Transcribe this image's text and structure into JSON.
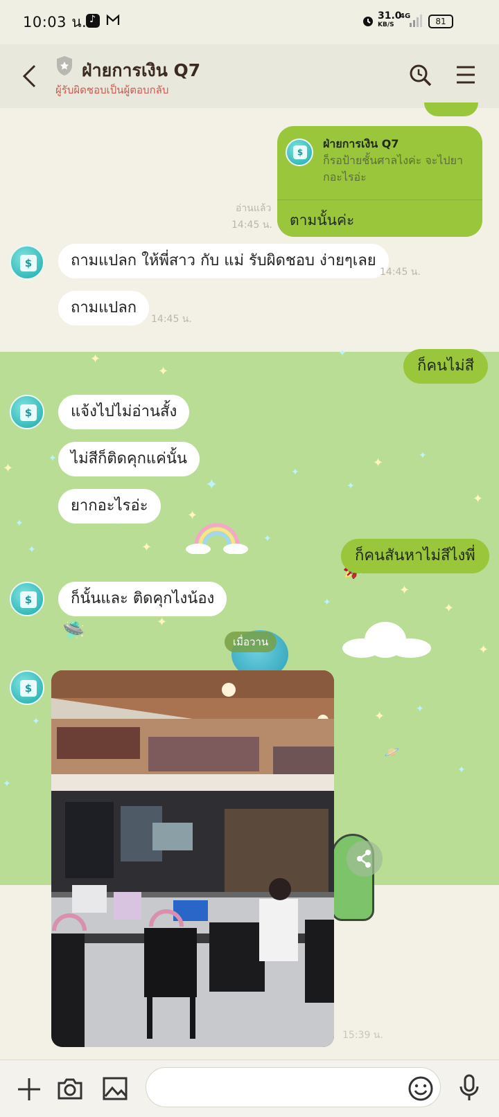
{
  "status_bar": {
    "time": "10:03 น.",
    "net_speed": "31.0",
    "net_unit": "KB/S",
    "network": "4G",
    "battery": "81"
  },
  "header": {
    "title": "ฝ่ายการเงิน Q7",
    "subtitle": "ผู้รับผิดชอบเป็นผู้ตอบกลับ"
  },
  "messages": {
    "reply": {
      "quoted_name": "ฝ่ายการเงิน Q7",
      "quoted_text": "ก็รอป้ายชั้นศาลไงค่ะ จะไปยากอะไรอ่ะ",
      "text": "ตามนั้นค่ะ",
      "read": "อ่านแล้ว",
      "time": "14:45 น."
    },
    "in1": {
      "text": "ถามแปลก ให้พี่สาว กับ แม่ รับผิดชอบ ง่ายๆเลย",
      "time": "14:45 น."
    },
    "in2": {
      "text": "ถามแปลก",
      "time": "14:45 น."
    },
    "out1": {
      "text": "ก็คนไม่สี"
    },
    "in3": {
      "text": "แจ้งไปไม่อ่านสั้ง"
    },
    "in4": {
      "text": "ไม่สีก็ติดคุกแค่นั้น"
    },
    "in5": {
      "text": "ยากอะไรอ่ะ"
    },
    "out2": {
      "text": "ก็คนสันหาไม่สีไงพี่"
    },
    "in6": {
      "text": "ก็นั้นและ ติดคุกไงน้อง"
    },
    "date_divider": "เมื่อวาน",
    "photo_time": "15:39 น."
  },
  "input": {
    "placeholder": ""
  },
  "colors": {
    "outgoing_bubble": "#9ac63c",
    "chat_background": "#b9dd94",
    "subtitle": "#d0584c"
  },
  "icons": [
    "back-arrow-icon",
    "shield-icon",
    "search-icon",
    "menu-icon",
    "plus-icon",
    "camera-icon",
    "gallery-icon",
    "emoji-icon",
    "mic-icon",
    "share-icon"
  ]
}
